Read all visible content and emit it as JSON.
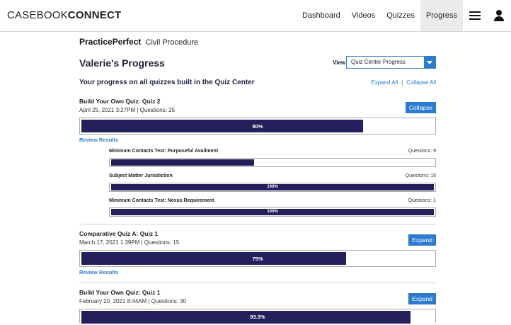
{
  "nav": {
    "brand_light": "CASEBOOK",
    "brand_bold": "CONNECT",
    "links": [
      "Dashboard",
      "Videos",
      "Quizzes",
      "Progress"
    ]
  },
  "header": {
    "product_bold": "PracticePerfect",
    "product_course": "Civil Procedure",
    "title": "Valerie's Progress",
    "view_label": "View:",
    "view_selected": "Quiz Center Progress",
    "subtitle": "Your progress on all quizzes built in the Quiz Center",
    "expand_all": "Expand All",
    "separator": "|",
    "collapse_all": "Collapse All"
  },
  "quizzes": [
    {
      "name": "Build Your Own Quiz: Quiz 2",
      "meta": "April 25, 2021 3:27PM  |  Questions: 25",
      "button": "Collapse",
      "percent": 80,
      "percent_label": "80%",
      "review": "Review Results",
      "subtopics": [
        {
          "name": "Minimum Contacts Test: Purposeful Availment",
          "questions": "Questions: 9",
          "percent": 44.4,
          "percent_label": "44.4%"
        },
        {
          "name": "Subject Matter Jurisdiction",
          "questions": "Questions: 15",
          "percent": 100,
          "percent_label": "100%"
        },
        {
          "name": "Minimum Contacts Test: Nexus Requirement",
          "questions": "Questions: 1",
          "percent": 100,
          "percent_label": "100%"
        }
      ]
    },
    {
      "name": "Comparative Quiz A: Quiz 1",
      "meta": "March 17, 2021 1:39PM  |  Questions: 15",
      "button": "Expand",
      "percent": 75,
      "percent_label": "75%",
      "review": "Review Results"
    },
    {
      "name": "Build Your Own Quiz: Quiz 1",
      "meta": "February 20, 2021 8:44AM  |  Questions: 30",
      "button": "Expand",
      "percent": 93.3,
      "percent_label": "93.3%"
    }
  ]
}
